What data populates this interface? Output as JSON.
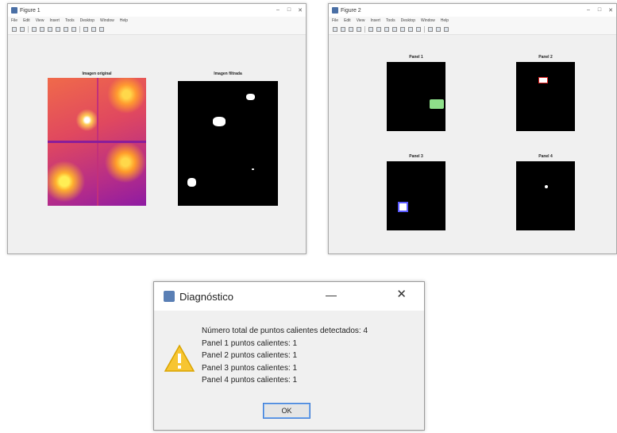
{
  "window1": {
    "title": "Figure 1",
    "menu": [
      "File",
      "Edit",
      "View",
      "Insert",
      "Tools",
      "Desktop",
      "Window",
      "Help"
    ],
    "left_title": "Imagen original",
    "right_title": "Imagen filtrada"
  },
  "window2": {
    "title": "Figure 2",
    "menu": [
      "File",
      "Edit",
      "View",
      "Insert",
      "Tools",
      "Desktop",
      "Window",
      "Help"
    ],
    "panels": [
      {
        "title": "Panel 1"
      },
      {
        "title": "Panel 2"
      },
      {
        "title": "Panel 3"
      },
      {
        "title": "Panel 4"
      }
    ]
  },
  "dialog": {
    "title": "Diagnóstico",
    "lines": [
      "Número total de puntos calientes detectados: 4",
      "Panel 1 puntos calientes: 1",
      "Panel 2 puntos calientes: 1",
      "Panel 3 puntos calientes: 1",
      "Panel 4 puntos calientes: 1"
    ],
    "ok_label": "OK"
  }
}
